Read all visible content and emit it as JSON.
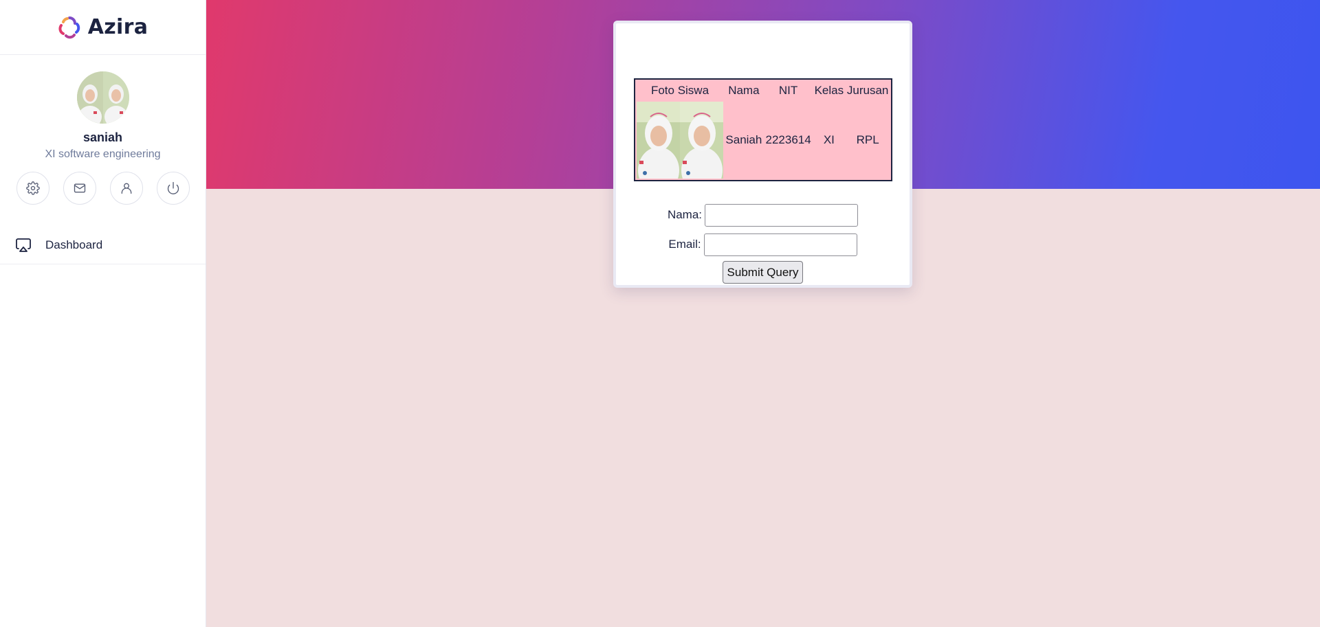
{
  "brand": {
    "name": "Azira"
  },
  "profile": {
    "name": "saniah",
    "subtitle": "XI software engineering"
  },
  "profile_actions": [
    {
      "icon": "gear-icon"
    },
    {
      "icon": "mail-icon"
    },
    {
      "icon": "user-icon"
    },
    {
      "icon": "power-icon"
    }
  ],
  "nav": {
    "items": [
      {
        "icon": "airplay-icon",
        "label": "Dashboard"
      }
    ]
  },
  "header": {
    "gradient": [
      "#e0396c",
      "#b43f96",
      "#7d4bc6",
      "#3d55ef"
    ]
  },
  "student_table": {
    "headers": [
      "Foto Siswa",
      "Nama",
      "NIT",
      "Kelas",
      "Jurusan"
    ],
    "rows": [
      {
        "nama": "Saniah",
        "nit": "2223614",
        "kelas": "XI",
        "jurusan": "RPL"
      }
    ],
    "background": "#ffc0cb"
  },
  "form": {
    "nama_label": "Nama:",
    "nama_value": "",
    "email_label": "Email:",
    "email_value": "",
    "submit_label": "Submit Query"
  },
  "colors": {
    "page_bg": "#f1dedf",
    "text": "#1c2340",
    "sidebar_bg": "#ffffff"
  }
}
